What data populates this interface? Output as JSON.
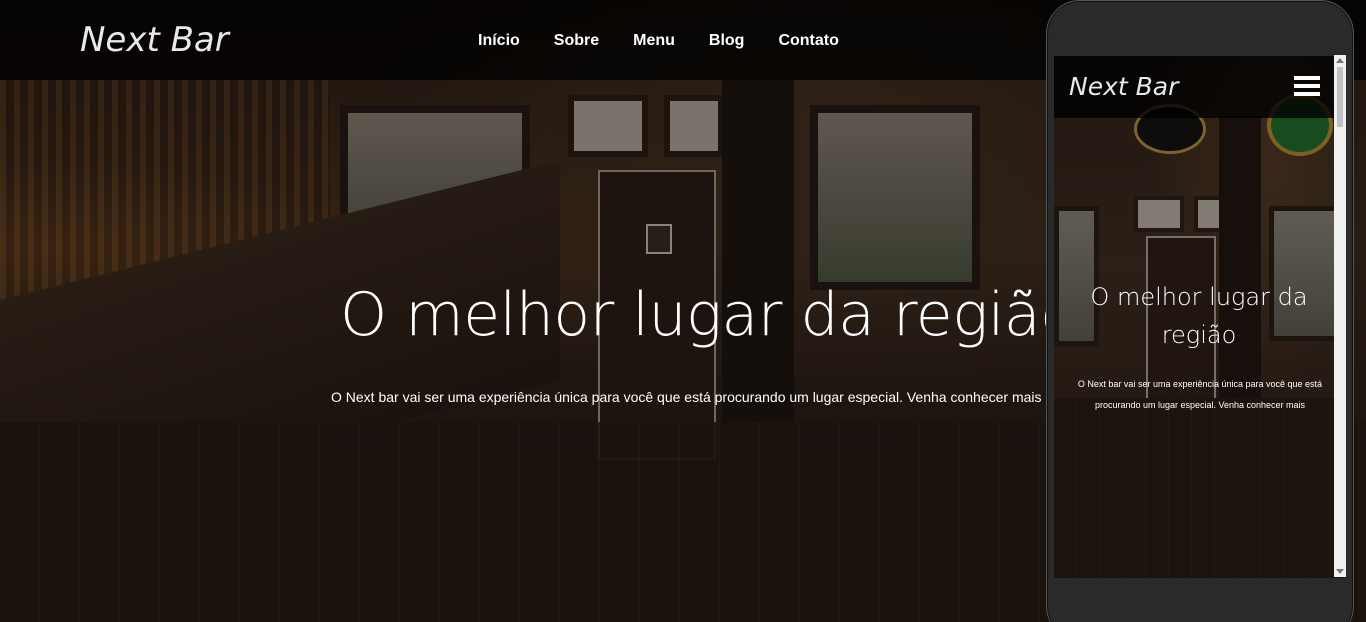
{
  "header": {
    "logo": "Next Bar",
    "nav": [
      "Início",
      "Sobre",
      "Menu",
      "Blog",
      "Contato"
    ]
  },
  "hero": {
    "title": "O melhor lugar da região",
    "subtitle": "O Next bar vai ser uma experiência única para você que está procurando um lugar especial. Venha conhecer mais"
  },
  "phone": {
    "logo": "Next Bar",
    "menu_icon": "hamburger-menu-icon",
    "title": "O melhor lugar da região",
    "subtitle": "O Next bar vai ser uma experiência única para você que está procurando um lugar especial. Venha conhecer mais"
  },
  "colors": {
    "header_bg": "#000000",
    "text": "#ffffff",
    "phone_frame": "#2a2a2a"
  }
}
